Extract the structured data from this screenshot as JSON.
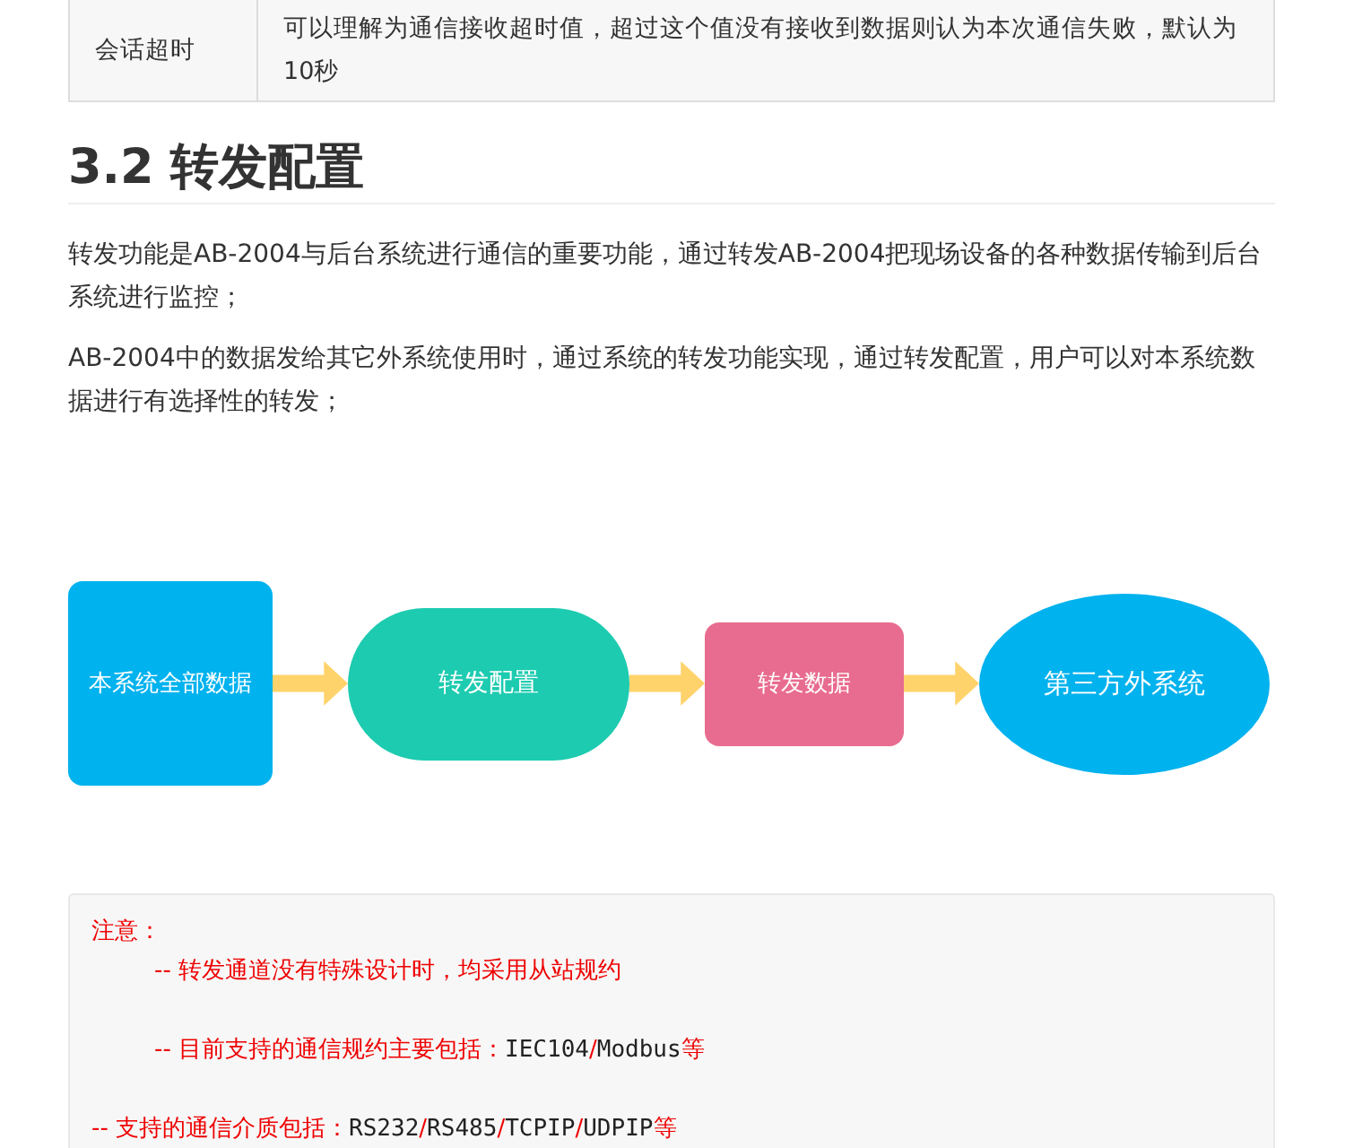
{
  "table": {
    "rows": [
      {
        "name": "会话超时",
        "description": "可以理解为通信接收超时值，超过这个值没有接收到数据则认为本次通信失败，默认为10秒"
      }
    ]
  },
  "section": {
    "heading": "3.2 转发配置",
    "paragraphs": [
      "转发功能是AB-2004与后台系统进行通信的重要功能，通过转发AB-2004把现场设备的各种数据传输到后台系统进行监控；",
      "AB-2004中的数据发给其它外系统使用时，通过系统的转发功能实现，通过转发配置，用户可以对本系统数据进行有选择性的转发；"
    ]
  },
  "flow_diagram": {
    "nodes": [
      {
        "kind": "rounded-box",
        "label": "本系统全部数据",
        "color": "#00b2ee"
      },
      {
        "kind": "pill",
        "label": "转发配置",
        "color": "#1dcbb0"
      },
      {
        "kind": "rounded-box",
        "label": "转发数据",
        "color": "#e86c8f"
      },
      {
        "kind": "ellipse",
        "label": "第三方外系统",
        "color": "#00b2ee"
      }
    ]
  },
  "note_block": {
    "lines": [
      {
        "indent": false,
        "segments": [
          {
            "kind": "text",
            "text": "注意："
          }
        ]
      },
      {
        "indent": true,
        "segments": [
          {
            "kind": "text",
            "text": "-- 转发通道没有特殊设计时，均采用从站规约"
          }
        ]
      },
      {
        "indent": true,
        "segments": [
          {
            "kind": "text",
            "text": "-- 目前支持的通信规约主要包括："
          },
          {
            "kind": "code",
            "text": "IEC104"
          },
          {
            "kind": "text",
            "text": "/"
          },
          {
            "kind": "code",
            "text": "Modbus"
          },
          {
            "kind": "text",
            "text": "等"
          }
        ]
      },
      {
        "indent": false,
        "segments": [
          {
            "kind": "text",
            "text": "-- 支持的通信介质包括："
          },
          {
            "kind": "code",
            "text": "RS232"
          },
          {
            "kind": "text",
            "text": "/"
          },
          {
            "kind": "code",
            "text": "RS485"
          },
          {
            "kind": "text",
            "text": "/"
          },
          {
            "kind": "code",
            "text": "TCPIP"
          },
          {
            "kind": "text",
            "text": "/"
          },
          {
            "kind": "code",
            "text": "UDPIP"
          },
          {
            "kind": "text",
            "text": "等"
          }
        ]
      }
    ]
  }
}
